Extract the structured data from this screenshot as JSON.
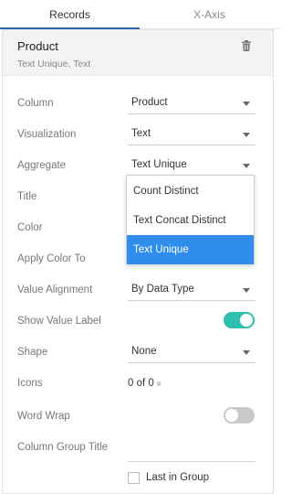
{
  "tabs": [
    {
      "label": "Records",
      "active": true
    },
    {
      "label": "X-Axis",
      "active": false
    }
  ],
  "header": {
    "title": "Product",
    "subtitle": "Text Unique, Text",
    "delete_icon": "trash-icon"
  },
  "fields": {
    "column": {
      "label": "Column",
      "value": "Product"
    },
    "visualization": {
      "label": "Visualization",
      "value": "Text"
    },
    "aggregate": {
      "label": "Aggregate",
      "value": "Text Unique"
    },
    "title": {
      "label": "Title"
    },
    "color": {
      "label": "Color"
    },
    "apply_color_to": {
      "label": "Apply Color To"
    },
    "value_alignment": {
      "label": "Value Alignment",
      "value": "By Data Type"
    },
    "show_value_label": {
      "label": "Show Value Label",
      "on": true
    },
    "shape": {
      "label": "Shape",
      "value": "None"
    },
    "icons": {
      "label": "Icons",
      "value": "0 of 0",
      "chevron": "»"
    },
    "word_wrap": {
      "label": "Word Wrap",
      "on": false
    },
    "column_group_title": {
      "label": "Column Group Title"
    },
    "last_in_group": {
      "label": "Last in Group",
      "checked": false
    }
  },
  "aggregate_dropdown": {
    "options": [
      "Count Distinct",
      "Text Concat Distinct",
      "Text Unique"
    ],
    "selected": "Text Unique"
  },
  "colors": {
    "accent": "#2b6aa8",
    "toggle_on": "#2ebfb0",
    "selected_option": "#2f8ded"
  }
}
